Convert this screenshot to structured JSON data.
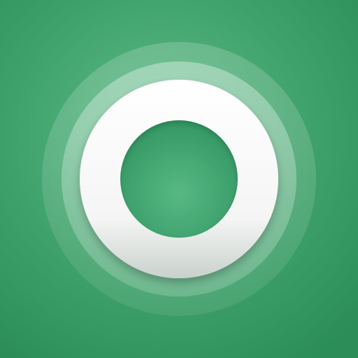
{
  "icon": {
    "semantic_name": "ring-logo-icon",
    "colors": {
      "background_light": "#5fbd88",
      "background_mid": "#3fa16b",
      "background_dark": "#2c8d58",
      "ring_outer_halo": "#cfe3d8",
      "ring_middle_halo": "#e4ece7",
      "ring_main": "#ffffff",
      "ring_shadow": "#b9c4bd",
      "center_hole_light": "#58b884",
      "center_hole_dark": "#2f9460"
    }
  }
}
